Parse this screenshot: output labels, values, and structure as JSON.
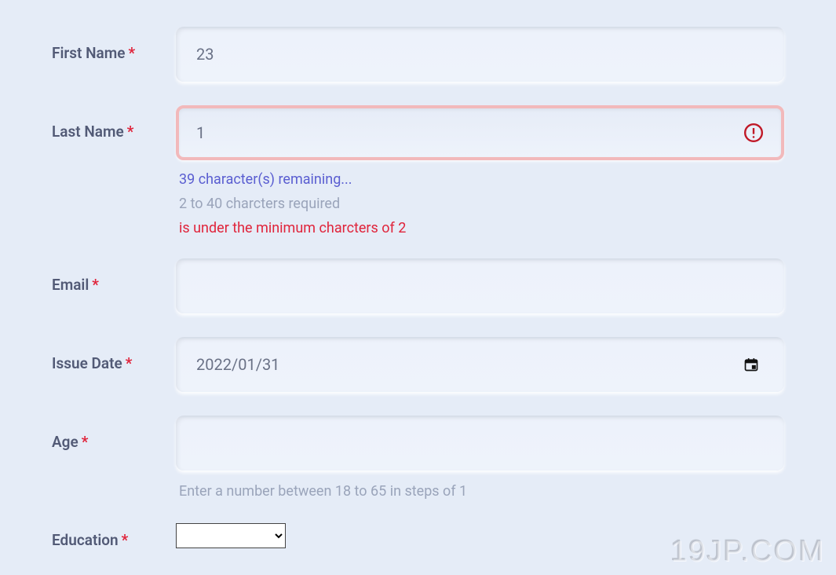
{
  "form": {
    "firstName": {
      "label": "First Name",
      "required": true,
      "value": "23"
    },
    "lastName": {
      "label": "Last Name",
      "required": true,
      "value": "1",
      "remainingText": "39 character(s) remaining...",
      "ruleText": "2 to 40 charcters required",
      "errorText": "is under the minimum charcters of 2"
    },
    "email": {
      "label": "Email",
      "required": true,
      "value": ""
    },
    "issueDate": {
      "label": "Issue Date",
      "required": true,
      "value": "2022/01/31"
    },
    "age": {
      "label": "Age",
      "required": true,
      "value": "",
      "hint": "Enter a number between 18 to 65 in steps of 1"
    },
    "education": {
      "label": "Education",
      "required": true,
      "selected": ""
    }
  },
  "watermark": "19JP.COM"
}
